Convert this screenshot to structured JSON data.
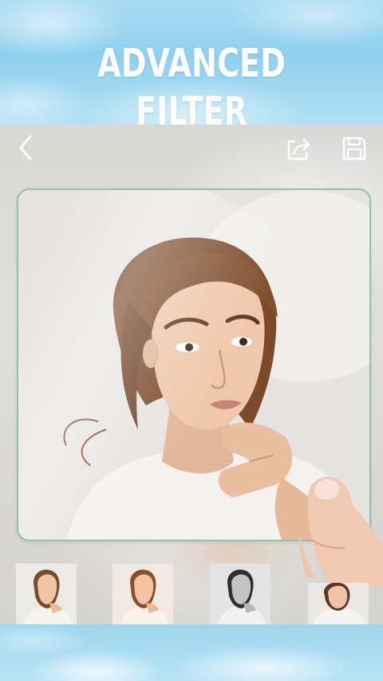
{
  "banner": {
    "title": "ADVANCED FILTER"
  },
  "toolbar": {
    "back_icon": "chevron-left-icon",
    "share_icon": "share-icon",
    "save_icon": "floppy-disk-icon"
  },
  "photo": {
    "subject": "portrait-photo"
  },
  "filters": [
    {
      "name": "original-filter"
    },
    {
      "name": "warm-filter"
    },
    {
      "name": "black-white-filter"
    },
    {
      "name": "soft-filter"
    }
  ],
  "colors": {
    "banner_blue": "#8fd0ee",
    "card_border": "#8fc2a9",
    "icon_white": "#ffffff"
  }
}
